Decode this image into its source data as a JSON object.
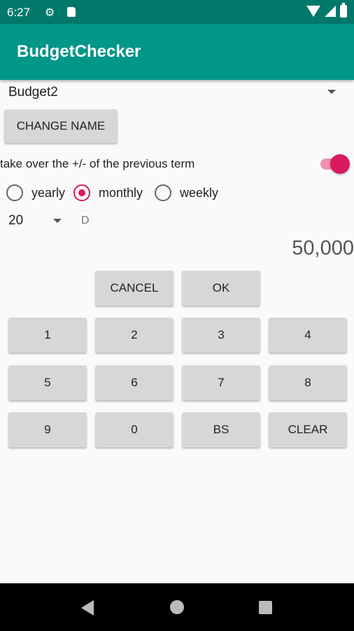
{
  "status": {
    "time": "6:27"
  },
  "app": {
    "title": "BudgetChecker"
  },
  "budget_name": "Budget2",
  "buttons": {
    "change_name": "CHANGE NAME",
    "cancel": "CANCEL",
    "ok": "OK"
  },
  "takeover_label": "take over the +/- of the previous term",
  "takeover_enabled": true,
  "period": {
    "yearly": "yearly",
    "monthly": "monthly",
    "weekly": "weekly",
    "selected": "monthly"
  },
  "day": {
    "value": "20",
    "unit": "D"
  },
  "amount": "50,000",
  "keypad": [
    "1",
    "2",
    "3",
    "4",
    "5",
    "6",
    "7",
    "8",
    "9",
    "0",
    "BS",
    "CLEAR"
  ],
  "colors": {
    "primary": "#009688",
    "primary_dark": "#00796b",
    "accent": "#d81b60"
  }
}
